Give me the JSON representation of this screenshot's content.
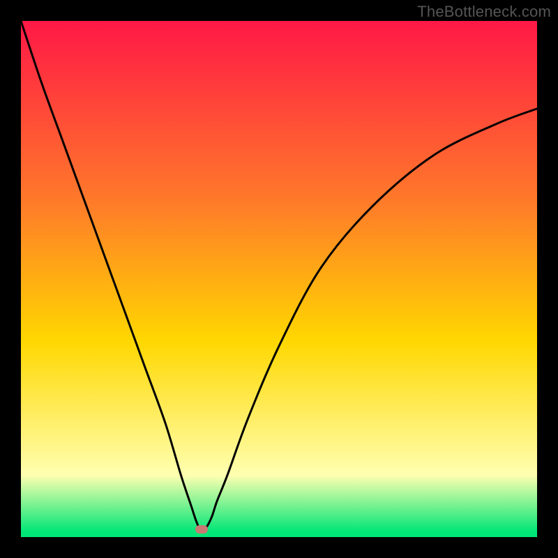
{
  "watermark": "TheBottleneck.com",
  "colors": {
    "gradient_top": "#ff1846",
    "gradient_mid1": "#ff7a2a",
    "gradient_mid2": "#ffd700",
    "gradient_mid3": "#ffffb0",
    "gradient_bottom": "#00e676",
    "curve": "#000000",
    "dot": "#c77b72",
    "frame": "#000000"
  },
  "chart_data": {
    "type": "line",
    "title": "",
    "xlabel": "",
    "ylabel": "",
    "xlim": [
      0,
      100
    ],
    "ylim": [
      0,
      100
    ],
    "annotations": [
      {
        "name": "minimum-marker",
        "x": 35,
        "y": 1.5
      }
    ],
    "series": [
      {
        "name": "bottleneck-curve",
        "x": [
          0,
          4,
          8,
          12,
          16,
          20,
          24,
          28,
          31,
          33,
          34,
          35,
          36,
          37,
          38,
          40,
          44,
          50,
          58,
          68,
          80,
          92,
          100
        ],
        "y": [
          100,
          88,
          77,
          66,
          55,
          44,
          33,
          22,
          12,
          6,
          3,
          1,
          2,
          4,
          7,
          12,
          23,
          37,
          52,
          64,
          74,
          80,
          83
        ]
      }
    ]
  }
}
